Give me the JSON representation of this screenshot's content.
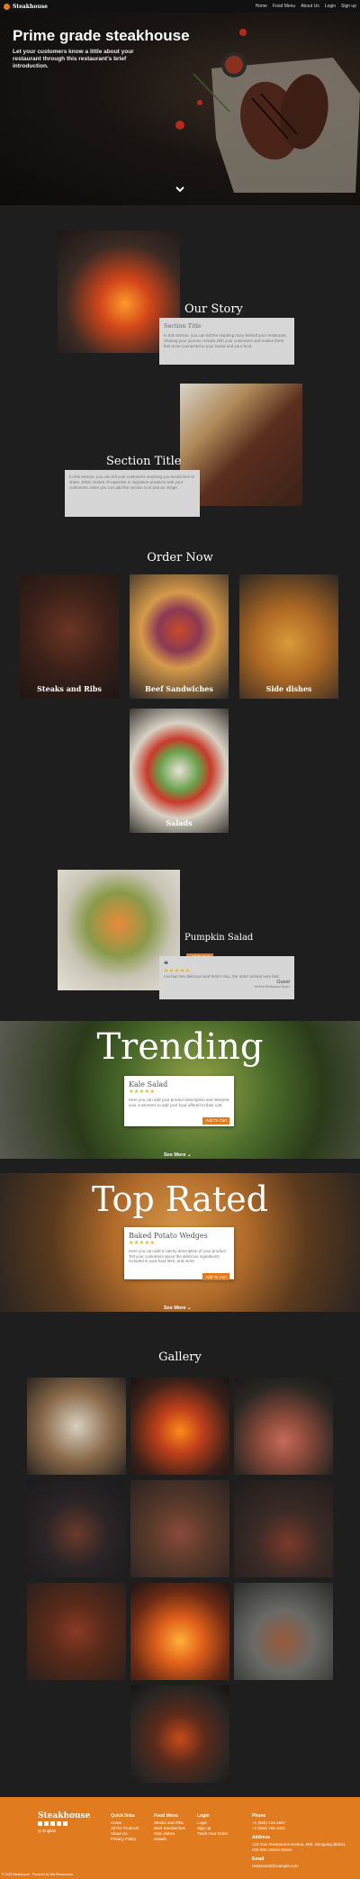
{
  "nav": {
    "brand": "Steakhouse",
    "links": [
      "Home",
      "Food Menu",
      "About Us",
      "Login",
      "Sign up"
    ]
  },
  "hero": {
    "title": "Prime grade steakhouse",
    "subtitle": "Let your customers know a little about your restaurant through this restaurant's brief introduction."
  },
  "story": {
    "heading": "Our Story",
    "card_title": "Section Title",
    "card_body": "In this section, you can tell the inspiring story behind your restaurant. Sharing your journey creates with your customers and makes them feel more connected to your brand and your food."
  },
  "section2": {
    "heading": "Section Title",
    "card_body": "In this section, you can tell your customers anything you would love to share. Enter stories of expertise or signature products with your customers. Here you can add the section icon and an image."
  },
  "order": {
    "heading": "Order Now",
    "tiles": [
      "Steaks and Ribs",
      "Beef Sandwiches",
      "Side dishes",
      "Salads"
    ]
  },
  "featured": {
    "title": "Pumpkin Salad",
    "button": "Add To Cart",
    "quote_mark": "❝",
    "stars": "★★★★★",
    "review": "I've had lots delicious and fresh! Also, the order arrived very fast.",
    "reviewer": "Guest",
    "reviewer_sub": "Verified Restaurant Buyer"
  },
  "trending": {
    "heading": "Trending",
    "card_title": "Kale Salad",
    "stars": "★★★★★",
    "card_body": "Here you can add your product description and interpret your customers to add your food offered to their cart.",
    "button": "Add To Cart",
    "see_more": "See More"
  },
  "top_rated": {
    "heading": "Top Rated",
    "card_title": "Baked Potato Wedges",
    "stars": "★★★★★",
    "card_body": "Here you can add a catchy description of your product. Tell your customers about the delicious ingredients included in your food item, and more.",
    "button": "Add To Cart",
    "see_more": "See More"
  },
  "gallery": {
    "heading": "Gallery"
  },
  "footer": {
    "brand": "Steakhouse",
    "language": "English",
    "quick_links": {
      "heading": "Quick links",
      "items": [
        "Home",
        "All the Products",
        "About Us",
        "Privacy Policy"
      ]
    },
    "food_menu": {
      "heading": "Food Menu",
      "items": [
        "Steaks and Ribs",
        "Beef Sandwiches",
        "Side dishes",
        "Salads"
      ]
    },
    "account": {
      "heading": "Login",
      "items": [
        "Login",
        "Sign up",
        "Track Your Order"
      ]
    },
    "contact": {
      "phone_h": "Phone",
      "phone": [
        "+1 (555) 123-4567",
        "+1 (555) 765-4321"
      ],
      "address_h": "Address",
      "address": [
        "123 Your Restaurant Avenue, 000, Shopping district,",
        "000 000 United States"
      ],
      "email_h": "Email",
      "email": "restaurant@example.com"
    },
    "copyright": "© 2023 Steakhouse · Powered by Wix Restaurants"
  },
  "colors": {
    "accent": "#e07b20",
    "bg": "#1e1e1e",
    "card": "#d6d6d6"
  }
}
